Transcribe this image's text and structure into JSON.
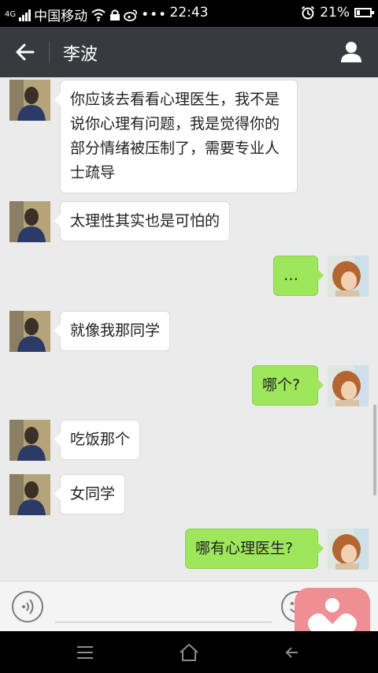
{
  "status_bar": {
    "network": "4G",
    "carrier": "中国移动",
    "time": "22:43",
    "battery": "21%",
    "battery_level": 0.21,
    "icons": [
      "signal-icon",
      "wifi-icon",
      "lock-icon",
      "weibo-icon",
      "more-icon",
      "alarm-icon",
      "battery-icon"
    ]
  },
  "header": {
    "title": "李波",
    "back_icon": "arrow-left-icon",
    "profile_icon": "person-icon"
  },
  "messages": [
    {
      "side": "left",
      "text": "你应该去看看心理医生，我不是说你心理有问题，我是觉得你的部分情绪被压制了，需要专业人士疏导"
    },
    {
      "side": "left",
      "text": "太理性其实也是可怕的"
    },
    {
      "side": "right",
      "text": "…"
    },
    {
      "side": "left",
      "text": "就像我那同学"
    },
    {
      "side": "right",
      "text": "哪个?"
    },
    {
      "side": "left",
      "text": "吃饭那个"
    },
    {
      "side": "left",
      "text": "女同学"
    },
    {
      "side": "right",
      "text": "哪有心理医生?"
    }
  ],
  "input_bar": {
    "voice_icon": "voice-icon",
    "emoji_icon": "emoji-icon"
  },
  "floating_app": {
    "icon": "heart-person-icon",
    "color": "#ee8f93"
  },
  "nav_bar": {
    "icons": [
      "menu-icon",
      "home-icon",
      "back-icon"
    ]
  },
  "colors": {
    "title_bar": "#393a3f",
    "sent_bubble": "#9ee75c",
    "received_bubble": "#ffffff",
    "chat_bg": "#ebebeb"
  }
}
